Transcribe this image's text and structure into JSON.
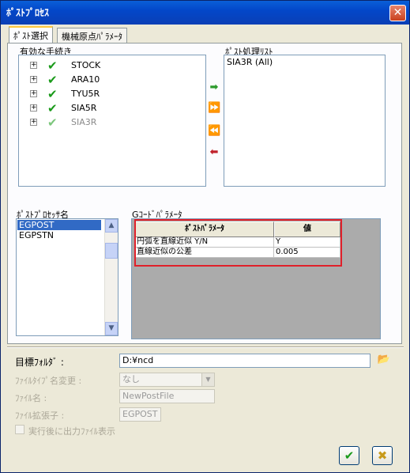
{
  "title": "ﾎﾟｽﾄﾌﾟﾛｾｽ",
  "tabs": [
    "ﾎﾟｽﾄ選択",
    "機械原点ﾊﾟﾗﾒｰﾀ"
  ],
  "procedures": {
    "label": "有効な手続き",
    "items": [
      "STOCK",
      "ARA10",
      "TYU5R",
      "SIA5R",
      "SIA3R"
    ]
  },
  "post_list": {
    "label": "ﾎﾟｽﾄ処理ﾘｽﾄ",
    "items": [
      "SIA3R (All)"
    ]
  },
  "processor": {
    "label": "ﾎﾟｽﾄﾌﾟﾛｾｯｻ名",
    "items": [
      "EGPOST",
      "EGPSTN"
    ]
  },
  "gcode": {
    "label": "Gｺｰﾄﾞﾊﾟﾗﾒｰﾀ",
    "col_param": "ﾎﾟｽﾄﾊﾟﾗﾒｰﾀ",
    "col_value": "値",
    "rows": [
      {
        "param": "円弧を直線近似 Y/N",
        "value": "Y"
      },
      {
        "param": "直線近似の公差",
        "value": "0.005"
      }
    ]
  },
  "form": {
    "target_folder_label": "目標ﾌｫﾙﾀﾞ :",
    "target_folder_value": "D:¥ncd",
    "filetype_label": "ﾌｧｲﾙﾀｲﾌﾟ名変更 :",
    "filetype_value": "なし",
    "filename_label": "ﾌｧｲﾙ名 :",
    "filename_value": "NewPostFile",
    "ext_label": "ﾌｧｲﾙ拡張子 :",
    "ext_value": "EGPOST",
    "show_after_label": "実行後に出力ﾌｧｲﾙ表示"
  },
  "colors": {
    "highlight": "#E0202A",
    "selection": "#316AC5",
    "check": "#1A9A1A"
  }
}
